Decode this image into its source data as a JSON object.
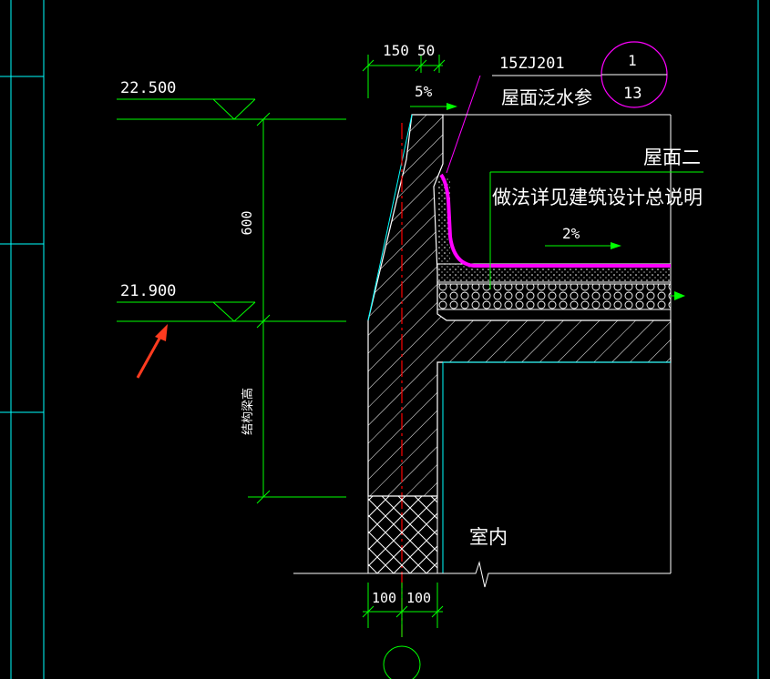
{
  "drawing": {
    "elevations": {
      "top": "22.500",
      "mid": "21.900"
    },
    "dimensions": {
      "height": "600",
      "beam_height": "结构梁高",
      "top_width_1": "150",
      "top_width_2": "50",
      "bottom_width_1": "100",
      "bottom_width_2": "100"
    },
    "slopes": {
      "coping": "5%",
      "roof": "2%"
    },
    "reference": {
      "atlas": "15ZJ201",
      "title": "屋面泛水参",
      "detail_number": "1",
      "sheet_number": "13"
    },
    "notes": {
      "roof_type": "屋面二",
      "method": "做法详见建筑设计总说明",
      "indoor": "室内"
    }
  },
  "colors": {
    "background": "#000000",
    "dimension_line": "#00ff00",
    "outline": "#ffffff",
    "frame": "#00ffff",
    "rebar": "#ff0000",
    "flashing": "#ff00ff",
    "arrow": "#ff3b1f"
  }
}
